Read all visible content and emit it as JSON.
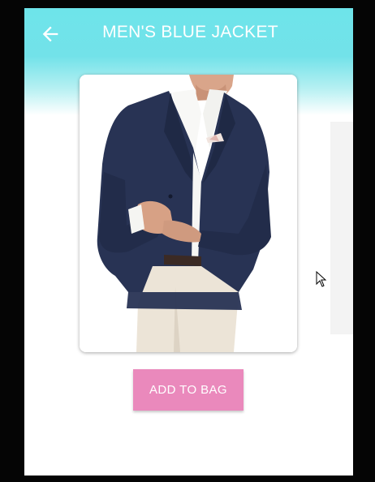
{
  "app_bar": {
    "title": "MEN'S BLUE JACKET",
    "back_icon": "arrow-left-icon"
  },
  "product": {
    "image_subject": "man in navy blazer and cream trousers"
  },
  "actions": {
    "add_to_bag_label": "ADD TO BAG",
    "add_to_bag_color": "#ea89bc"
  },
  "theme": {
    "header_color": "#6ee4ea"
  }
}
